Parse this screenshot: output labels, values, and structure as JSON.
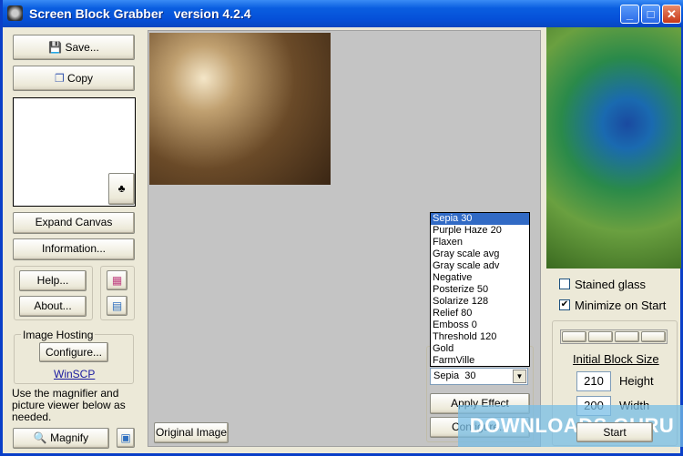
{
  "title": "Screen Block Grabber   version 4.2.4",
  "left": {
    "save": "Save...",
    "copy": "Copy",
    "expand": "Expand Canvas",
    "information": "Information...",
    "help": "Help...",
    "about": "About...",
    "hosting_label": "Image Hosting",
    "configure": "Configure...",
    "winscp": "WinSCP",
    "hint": "Use the magnifier and picture viewer below as needed.",
    "magnify": "Magnify"
  },
  "main": {
    "original": "Original Image"
  },
  "effects": {
    "options": [
      "Sepia  30",
      "Purple Haze  20",
      "Flaxen",
      "Gray scale avg",
      "Gray scale adv",
      "Negative",
      "Posterize  50",
      "Solarize  128",
      "Relief  80",
      "Emboss  0",
      "Threshold  120",
      "Gold",
      "FarmVille"
    ],
    "selected": "Sepia  30",
    "apply": "Apply Effect",
    "configure": "Configure..."
  },
  "right": {
    "stained": "Stained glass",
    "stained_checked": false,
    "minimize": "Minimize on Start",
    "minimize_checked": true,
    "block_title": "Initial Block Size",
    "height_val": "210",
    "height_label": "Height",
    "width_val": "200",
    "width_label": "Width",
    "start": "Start"
  },
  "watermark": "DOWNLOADS GURU"
}
